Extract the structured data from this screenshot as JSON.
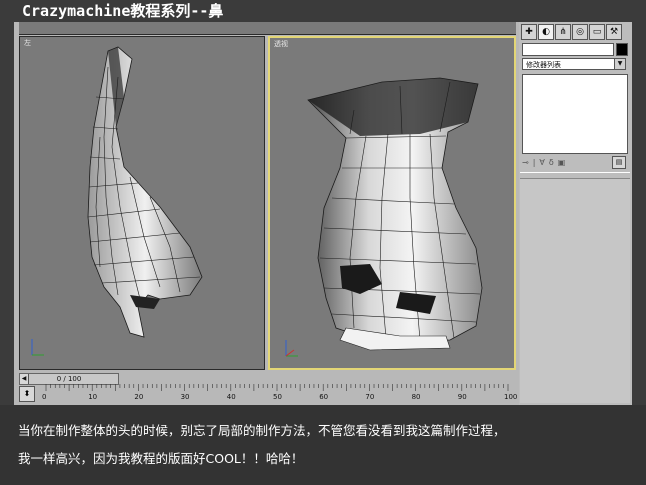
{
  "banner": {
    "title": "Crazymachine教程系列--鼻"
  },
  "viewports": {
    "left_label": "左",
    "persp_label": "透视",
    "active_border": "#e3d676"
  },
  "command_panel": {
    "tabs": [
      "create-icon",
      "modify-icon",
      "hierarchy-icon",
      "motion-icon",
      "display-icon",
      "utilities-icon"
    ],
    "modifier_list": "修改器列表"
  },
  "timeline": {
    "slider_text": "0 / 100",
    "ticks": [
      "0",
      "10",
      "20",
      "30",
      "40",
      "50",
      "60",
      "70",
      "80",
      "90",
      "100"
    ]
  },
  "caption": {
    "line1": "当你在制作整体的头的时候，别忘了局部的制作方法，不管您看没看到我这篇制作过程，",
    "line2": "我一样高兴，因为我教程的版面好COOL！！哈哈！"
  }
}
